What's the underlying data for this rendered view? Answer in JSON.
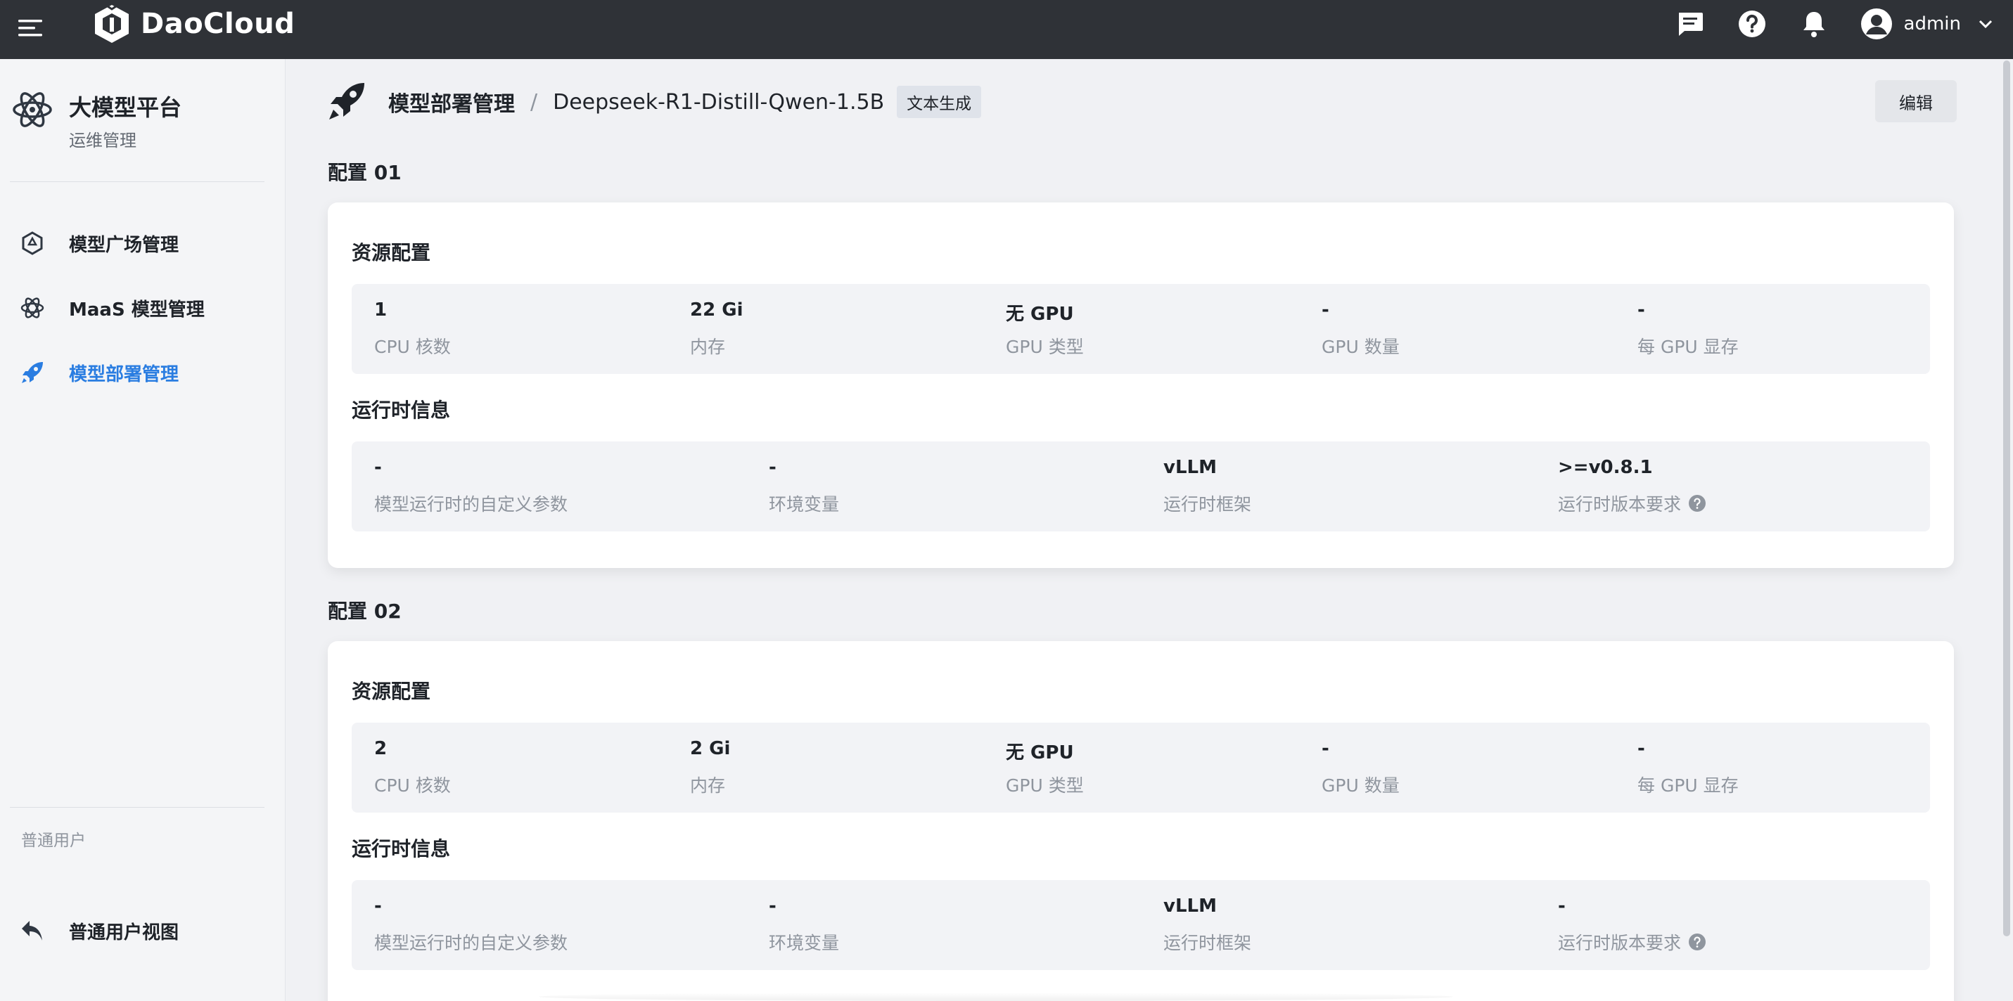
{
  "topbar": {
    "brand": "DaoCloud",
    "user": "admin"
  },
  "sidebar": {
    "title": "大模型平台",
    "subtitle": "运维管理",
    "items": [
      {
        "label": "模型广场管理",
        "icon": "hexagon-icon"
      },
      {
        "label": "MaaS 模型管理",
        "icon": "atom-icon"
      },
      {
        "label": "模型部署管理",
        "icon": "rocket-icon",
        "active": true
      }
    ],
    "section_label": "普通用户",
    "user_view": "普通用户视图"
  },
  "header": {
    "crumb_parent": "模型部署管理",
    "crumb_sep": "/",
    "crumb_current": "Deepseek-R1-Distill-Qwen-1.5B",
    "tag": "文本生成",
    "edit": "编辑"
  },
  "configs": [
    {
      "title": "配置 01",
      "resource_title": "资源配置",
      "resources": [
        {
          "value": "1",
          "key": "CPU 核数"
        },
        {
          "value": "22 Gi",
          "key": "内存"
        },
        {
          "value": "无 GPU",
          "key": "GPU 类型"
        },
        {
          "value": "-",
          "key": "GPU 数量"
        },
        {
          "value": "-",
          "key": "每 GPU 显存"
        }
      ],
      "runtime_title": "运行时信息",
      "runtime": [
        {
          "value": "-",
          "key": "模型运行时的自定义参数"
        },
        {
          "value": "-",
          "key": "环境变量"
        },
        {
          "value": "vLLM",
          "key": "运行时框架"
        },
        {
          "value": ">=v0.8.1",
          "key": "运行时版本要求"
        }
      ]
    },
    {
      "title": "配置 02",
      "resource_title": "资源配置",
      "resources": [
        {
          "value": "2",
          "key": "CPU 核数"
        },
        {
          "value": "2 Gi",
          "key": "内存"
        },
        {
          "value": "无 GPU",
          "key": "GPU 类型"
        },
        {
          "value": "-",
          "key": "GPU 数量"
        },
        {
          "value": "-",
          "key": "每 GPU 显存"
        }
      ],
      "runtime_title": "运行时信息",
      "runtime": [
        {
          "value": "-",
          "key": "模型运行时的自定义参数"
        },
        {
          "value": "-",
          "key": "环境变量"
        },
        {
          "value": "vLLM",
          "key": "运行时框架"
        },
        {
          "value": "-",
          "key": "运行时版本要求"
        }
      ]
    }
  ],
  "colors": {
    "topbar": "#2f3237",
    "accent": "#2a7de1",
    "page_bg": "#f0f1f4"
  }
}
